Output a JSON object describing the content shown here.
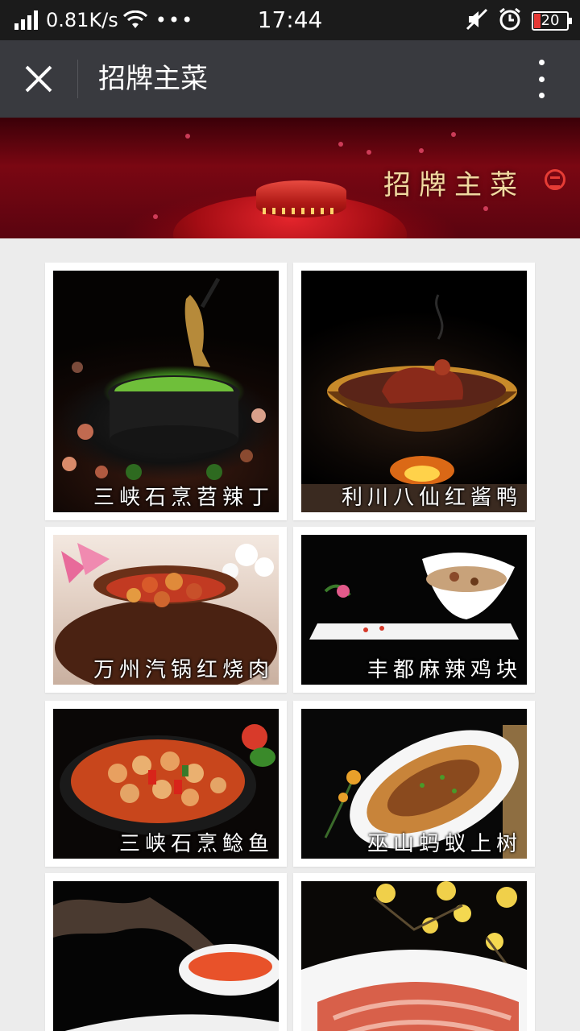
{
  "status_bar": {
    "speed": "0.81K/s",
    "dots": "•••",
    "time": "17:44",
    "battery": "20",
    "battery_color": "#e53935"
  },
  "nav": {
    "title": "招牌主菜",
    "close_icon": "close-icon",
    "more_icon": "more-vertical-icon"
  },
  "banner": {
    "title": "招牌主菜",
    "accent": "#c0101a"
  },
  "dishes": [
    {
      "name": "三峡石烹苕辣丁",
      "image": "fish-in-stone-pot"
    },
    {
      "name": "利川八仙红酱鸭",
      "image": "duck-in-brass-bowl"
    },
    {
      "name": "万州汽锅红烧肉",
      "image": "braised-pork-clay-pot"
    },
    {
      "name": "丰都麻辣鸡块",
      "image": "spicy-chicken-bowl"
    },
    {
      "name": "三峡石烹鲶鱼",
      "image": "catfish-stone-pot"
    },
    {
      "name": "巫山蚂蚁上树",
      "image": "ants-climbing-tree-noodles"
    },
    {
      "name": "",
      "image": "dish-with-sauce-dip"
    },
    {
      "name": "",
      "image": "sliced-meat-plate"
    }
  ]
}
